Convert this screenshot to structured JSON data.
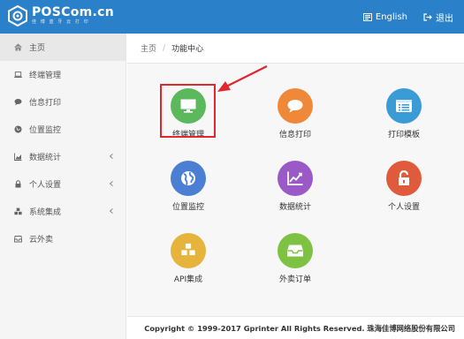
{
  "brand": {
    "name": "POSCom.cn",
    "tagline": "佳 博 蓝 牙 云 打 印",
    "color": "#2a80c9"
  },
  "topbar": {
    "language_label": "English",
    "logout_label": "退出"
  },
  "sidebar": {
    "items": [
      {
        "label": "主页",
        "icon": "home-icon",
        "active": true
      },
      {
        "label": "终端管理",
        "icon": "laptop-icon"
      },
      {
        "label": "信息打印",
        "icon": "comment-icon"
      },
      {
        "label": "位置监控",
        "icon": "globe-icon"
      },
      {
        "label": "数据统计",
        "icon": "chart-icon",
        "has_submenu": true
      },
      {
        "label": "个人设置",
        "icon": "lock-icon",
        "has_submenu": true
      },
      {
        "label": "系统集成",
        "icon": "cubes-icon",
        "has_submenu": true
      },
      {
        "label": "云外卖",
        "icon": "inbox-icon"
      }
    ]
  },
  "breadcrumb": {
    "home": "主页",
    "separator": "/",
    "current": "功能中心"
  },
  "tiles": [
    {
      "label": "终端管理",
      "icon": "monitor-icon",
      "color": "#5cb85c",
      "highlighted": true
    },
    {
      "label": "信息打印",
      "icon": "comment-icon",
      "color": "#f0883a"
    },
    {
      "label": "打印模板",
      "icon": "list-card-icon",
      "color": "#3a9bd6"
    },
    {
      "label": "位置监控",
      "icon": "globe-icon",
      "color": "#4a7fd4"
    },
    {
      "label": "数据统计",
      "icon": "line-chart-icon",
      "color": "#9b59c7"
    },
    {
      "label": "个人设置",
      "icon": "lock-open-icon",
      "color": "#e05a3c"
    },
    {
      "label": "API集成",
      "icon": "cubes-icon",
      "color": "#e6b43c"
    },
    {
      "label": "外卖订单",
      "icon": "inbox-icon",
      "color": "#7dc242"
    }
  ],
  "annotation": {
    "box_color": "#e0262e",
    "arrow_color": "#e0262e"
  },
  "footer": {
    "copyright": "Copyright © 1999-2017 Gprinter All Rights Reserved. 珠海佳博网络股份有限公司"
  }
}
